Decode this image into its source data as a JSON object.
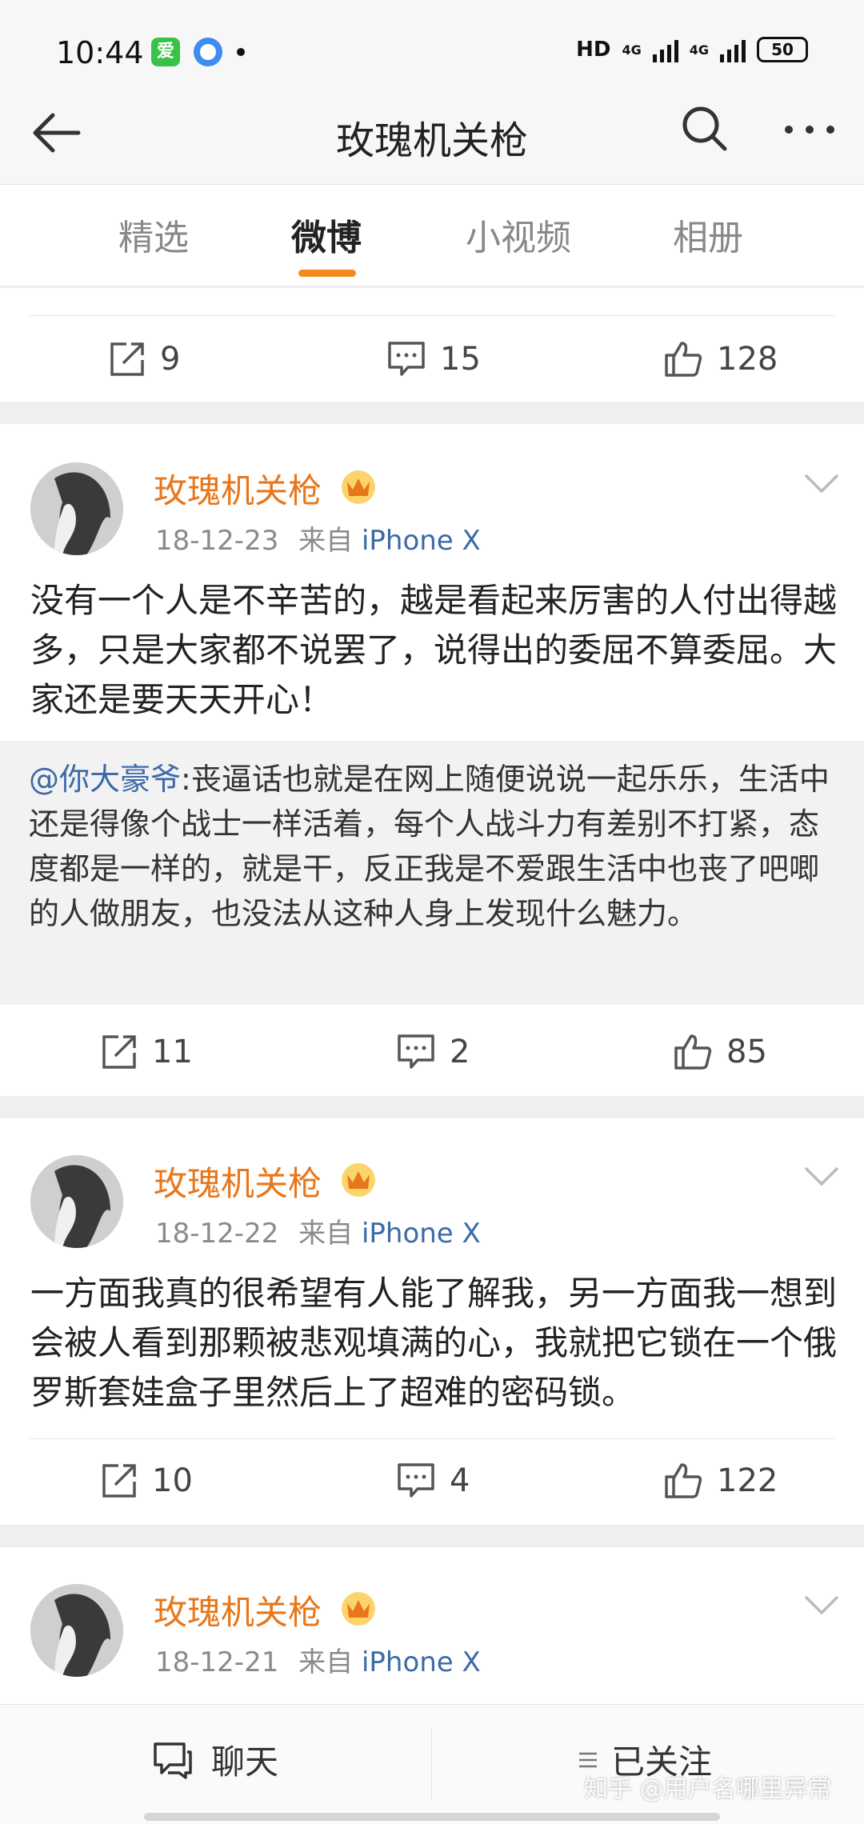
{
  "status_bar": {
    "time": "10:44",
    "app_icon_1": "iqiyi-icon",
    "app_icon_2": "qq-browser-icon",
    "network": "HD",
    "signal_1": "4G",
    "signal_2": "4G",
    "battery": "50"
  },
  "header": {
    "title": "玫瑰机关枪",
    "back_icon": "back-arrow-icon",
    "search_icon": "search-icon",
    "more_icon": "more-icon"
  },
  "tabs": [
    {
      "label": "精选",
      "active": false
    },
    {
      "label": "微博",
      "active": true
    },
    {
      "label": "小视频",
      "active": false
    },
    {
      "label": "相册",
      "active": false
    }
  ],
  "accent_color": "#f28b1f",
  "posts": [
    {
      "reposts": "9",
      "comments": "15",
      "likes": "128"
    },
    {
      "author": "玫瑰机关枪",
      "date": "18-12-23",
      "source_prefix": "来自",
      "source": "iPhone X",
      "content": "没有一个人是不辛苦的，越是看起来厉害的人付出得越多，只是大家都不说罢了，说得出的委屈不算委屈。大家还是要天天开心！",
      "quote_mention": "@你大豪爷",
      "quote_text": ":丧逼话也就是在网上随便说说一起乐乐，生活中还是得像个战士一样活着，每个人战斗力有差别不打紧，态度都是一样的，就是干，反正我是不爱跟生活中也丧了吧唧的人做朋友，也没法从这种人身上发现什么魅力。",
      "reposts": "11",
      "comments": "2",
      "likes": "85"
    },
    {
      "author": "玫瑰机关枪",
      "date": "18-12-22",
      "source_prefix": "来自",
      "source": "iPhone X",
      "content": "一方面我真的很希望有人能了解我，另一方面我一想到会被人看到那颗被悲观填满的心，我就把它锁在一个俄罗斯套娃盒子里然后上了超难的密码锁。",
      "reposts": "10",
      "comments": "4",
      "likes": "122"
    },
    {
      "author": "玫瑰机关枪",
      "date": "18-12-21",
      "source_prefix": "来自",
      "source": "iPhone X"
    }
  ],
  "bottom_bar": {
    "chat_label": "聊天",
    "follow_label": "已关注",
    "watermark": "知乎 @用户名哪里异常"
  }
}
